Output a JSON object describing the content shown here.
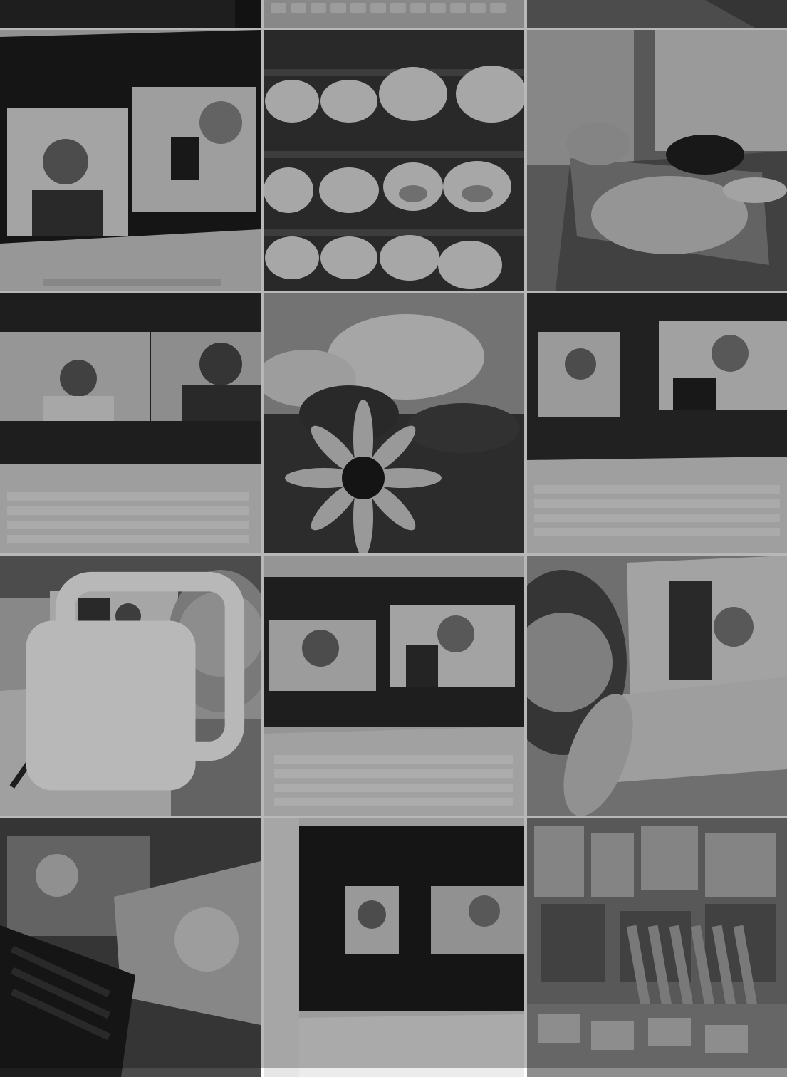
{
  "grid": {
    "columns": 3,
    "cells": [
      {
        "id": "top-1",
        "subject": "laptop-edge"
      },
      {
        "id": "top-2",
        "subject": "keyboard"
      },
      {
        "id": "top-3",
        "subject": "table"
      },
      {
        "id": "r1-1",
        "subject": "video-call-laptop-two-people"
      },
      {
        "id": "r1-2",
        "subject": "ceramic-bowls-shelf"
      },
      {
        "id": "r1-3",
        "subject": "soba-noodles-tempura"
      },
      {
        "id": "r2-1",
        "subject": "video-call-laptop-office"
      },
      {
        "id": "r2-2",
        "subject": "sunflower-clouds"
      },
      {
        "id": "r2-3",
        "subject": "video-call-laptop-two-windows"
      },
      {
        "id": "r3-1",
        "subject": "selfie-with-laptop-notes",
        "multi": true
      },
      {
        "id": "r3-2",
        "subject": "video-call-laptop-wave"
      },
      {
        "id": "r3-3",
        "subject": "selfie-peace-sign-laptop"
      },
      {
        "id": "r4-1",
        "subject": "macbook-video-call-peace"
      },
      {
        "id": "r4-2",
        "subject": "video-call-laptop-glasses"
      },
      {
        "id": "r4-3",
        "subject": "snack-shop-display"
      }
    ]
  },
  "icons": {
    "multi_post": "carousel-icon"
  },
  "colors": {
    "background": "#ffffff",
    "tile_dark": "#2e2e2e",
    "tile_mid": "#8a8a8a",
    "tile_light": "#cfcfcf"
  }
}
